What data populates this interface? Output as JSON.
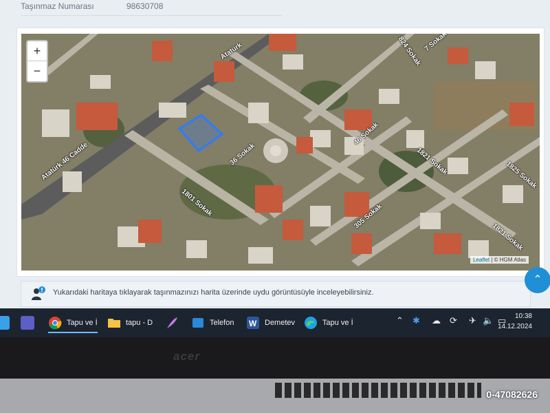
{
  "header": {
    "field_label": "Taşınmaz Numarası",
    "field_value": "98630708"
  },
  "map": {
    "zoom_in": "+",
    "zoom_out": "−",
    "attribution_leaflet": "Leaflet",
    "attribution_sep": " | © ",
    "attribution_source": "HGM Atlas",
    "streets": [
      "Atatürk",
      "Atatürk 46 Cadde",
      "36 Sokak",
      "1801 Sokak",
      "46 Sokak",
      "824 Sokak",
      "1821 Sokak",
      "305 Sokak",
      "1825 Sokak",
      "1821 Sokak",
      "7 Sokak"
    ]
  },
  "info": {
    "text": "Yukarıdaki haritaya tıklayarak taşınmazınızı harita üzerinde uydu görüntüsüyle inceleyebilirsiniz."
  },
  "scroll_top": "⌃",
  "taskbar": {
    "items": [
      {
        "label": "Tapu ve İ",
        "icon": "chrome-icon"
      },
      {
        "label": "tapu - D",
        "icon": "folder-icon"
      },
      {
        "label": "",
        "icon": "feather-icon"
      },
      {
        "label": "Telefon",
        "icon": "phone-link-icon"
      },
      {
        "label": "Demetev",
        "icon": "word-icon"
      },
      {
        "label": "Tapu ve İ",
        "icon": "edge-icon"
      }
    ],
    "time": "10:38",
    "date": "14.12.2024"
  },
  "laptop": {
    "brand": "acer"
  },
  "watermark": "0-47082626",
  "colors": {
    "parcel_outline": "#2f7bff",
    "taskbar_bg": "#1c2430",
    "accent": "#1f8fd6"
  }
}
